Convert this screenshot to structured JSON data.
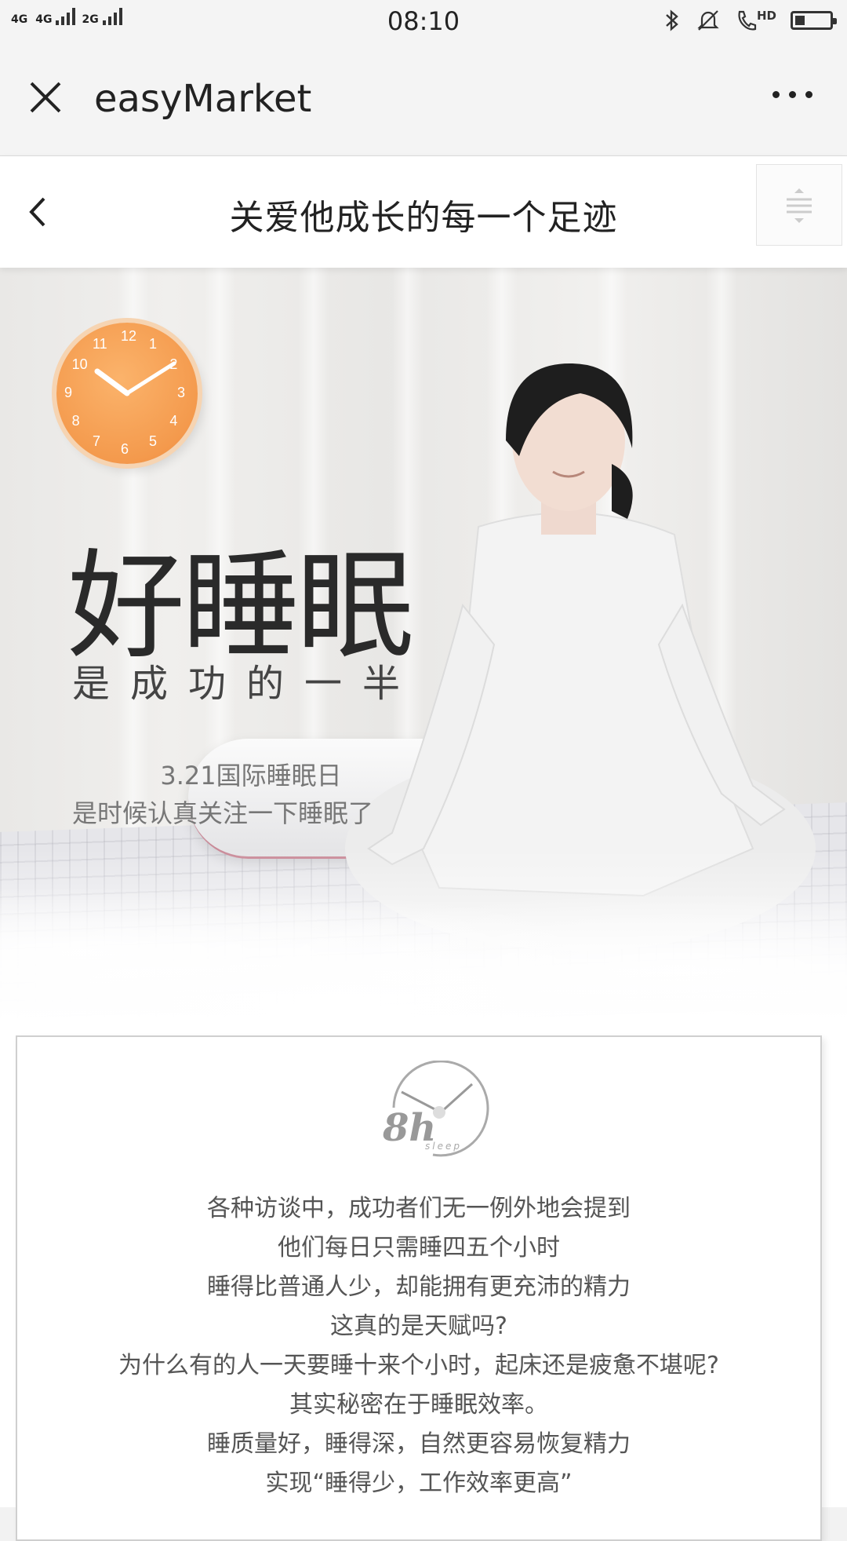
{
  "status_bar": {
    "network_1": "4G",
    "network_2": "4G",
    "network_3": "2G",
    "time": "08:10",
    "call_badge": "HD"
  },
  "app_bar": {
    "title": "easyMarket"
  },
  "page_header": {
    "title": "关爱他成长的每一个足迹"
  },
  "hero": {
    "headline": "好睡眠",
    "subheadline": "是成功的一半",
    "date_line": "3.21国际睡眠日",
    "tag_line": "是时候认真关注一下睡眠了",
    "clock_numbers": [
      "12",
      "1",
      "2",
      "3",
      "4",
      "5",
      "6",
      "7",
      "8",
      "9",
      "10",
      "11"
    ]
  },
  "card": {
    "logo_text": "8h",
    "logo_subtext": "sleep",
    "lines": [
      "各种访谈中，成功者们无一例外地会提到",
      "他们每日只需睡四五个小时",
      "睡得比普通人少，却能拥有更充沛的精力",
      "这真的是天赋吗?",
      "为什么有的人一天要睡十来个小时，起床还是疲惫不堪呢?",
      "其实秘密在于睡眠效率。",
      "睡质量好，睡得深，自然更容易恢复精力",
      "实现“睡得少，工作效率更高”"
    ]
  },
  "colors": {
    "clock_orange": "#f49a4d",
    "text_dark": "#222222",
    "text_gray": "#555555"
  }
}
